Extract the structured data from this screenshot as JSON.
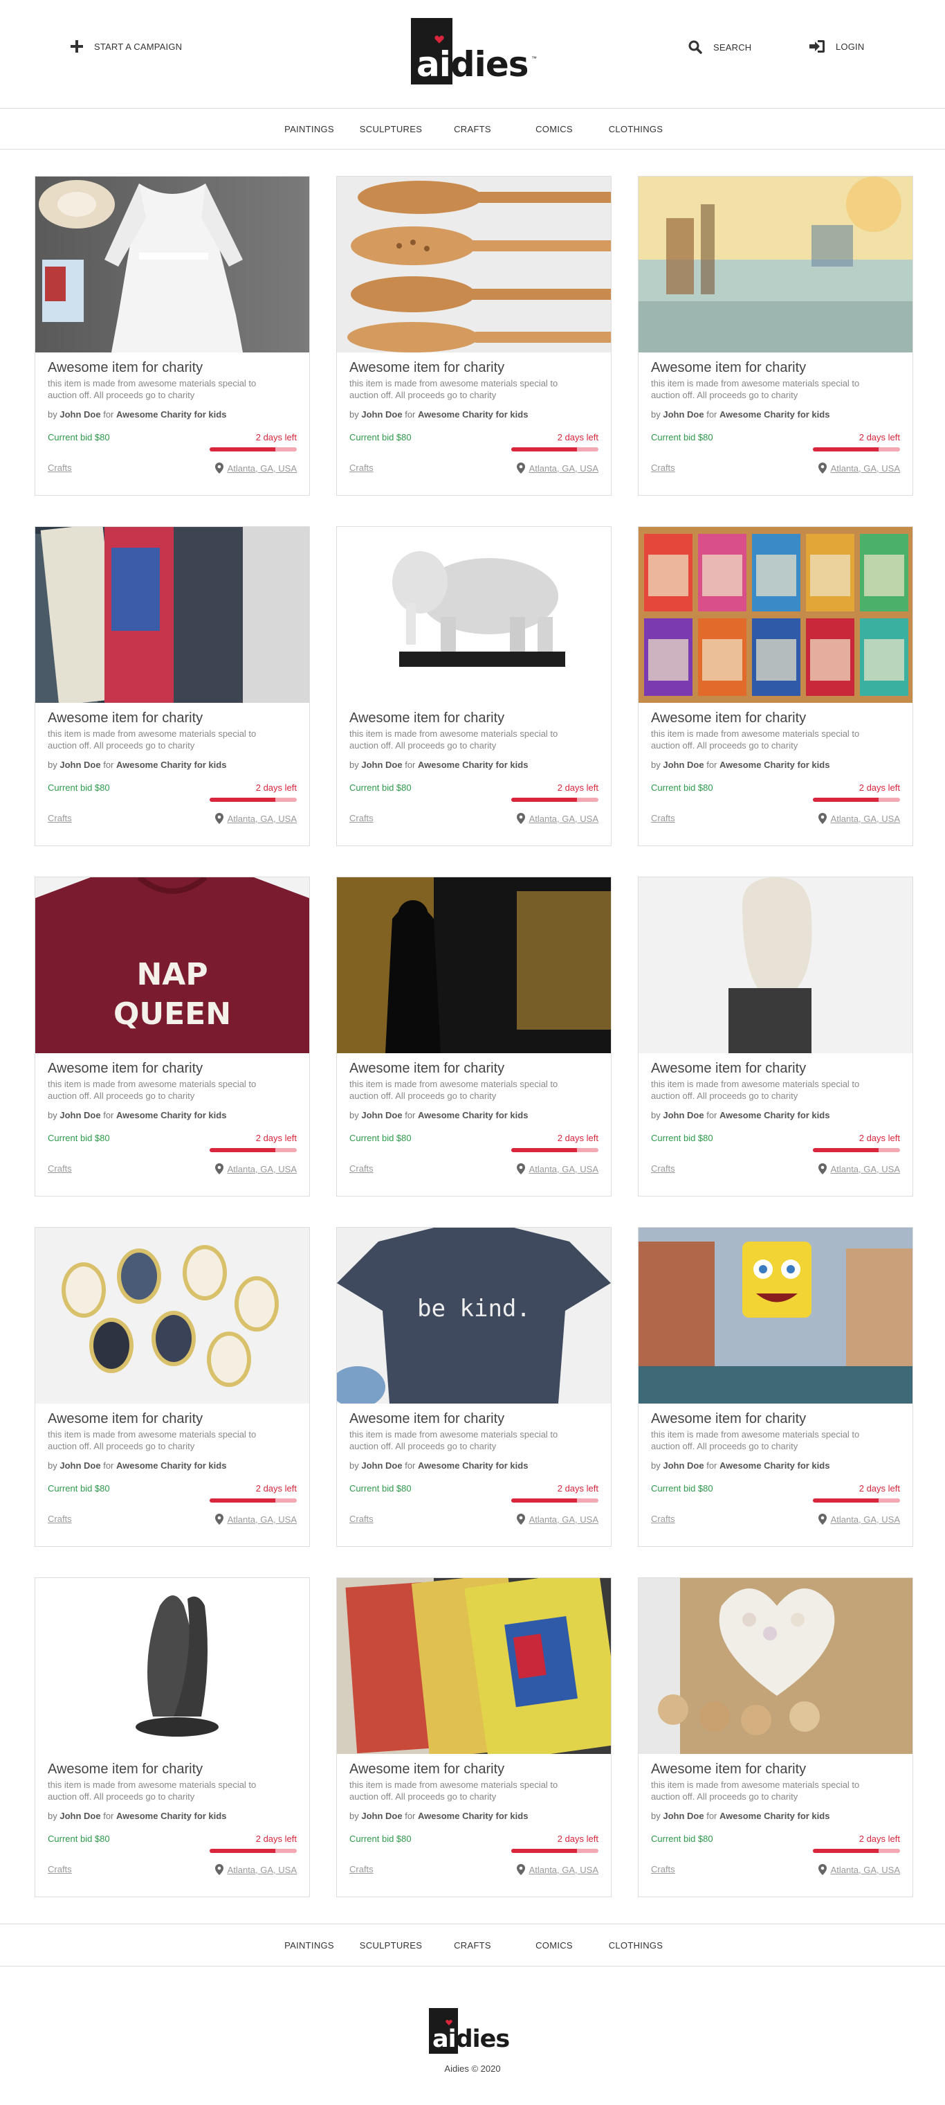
{
  "header": {
    "start_campaign": "START A CAMPAIGN",
    "search": "SEARCH",
    "login": "LOGIN",
    "logo_text_a": "ai",
    "logo_text_b": "dies",
    "logo_tm": "™"
  },
  "categories": [
    "PAINTINGS",
    "SCULPTURES",
    "CRAFTS",
    "COMICS",
    "CLOTHINGS"
  ],
  "card_common": {
    "title": "Awesome item for charity",
    "description": "this item is made from awesome materials special to auction off. All proceeds go to charity",
    "by_prefix": "by",
    "seller": "John Doe",
    "for_word": "for",
    "charity": "Awesome Charity for kids",
    "bid": "Current bid $80",
    "days_left": "2 days left",
    "time_progress": 0.75,
    "category": "Crafts",
    "location": "Atlanta, GA, USA"
  },
  "cards": [
    {
      "image": "white-lace-dress"
    },
    {
      "image": "wooden-spoons"
    },
    {
      "image": "watercolor-cityscape"
    },
    {
      "image": "comic-books-fan"
    },
    {
      "image": "white-elephant-sculpture"
    },
    {
      "image": "vintage-comics-grid"
    },
    {
      "image": "nap-queen-sweatshirt"
    },
    {
      "image": "dark-gold-painting"
    },
    {
      "image": "abstract-head-sculpture"
    },
    {
      "image": "embroidered-necklaces"
    },
    {
      "image": "be-kind-tshirt"
    },
    {
      "image": "spongebob-venice-painting"
    },
    {
      "image": "hands-sculpture"
    },
    {
      "image": "superman-comics-stack"
    },
    {
      "image": "button-heart-craft"
    }
  ],
  "image_text": {
    "nap": "NAP",
    "queen": "QUEEN",
    "be_kind": "be kind."
  },
  "footer": {
    "copyright": "Aidies © 2020"
  },
  "colors": {
    "bid_green": "#2e9a4b",
    "days_red": "#d9263c",
    "bar_track": "#f2a9b3",
    "brand_dark": "#1a1a1a"
  }
}
